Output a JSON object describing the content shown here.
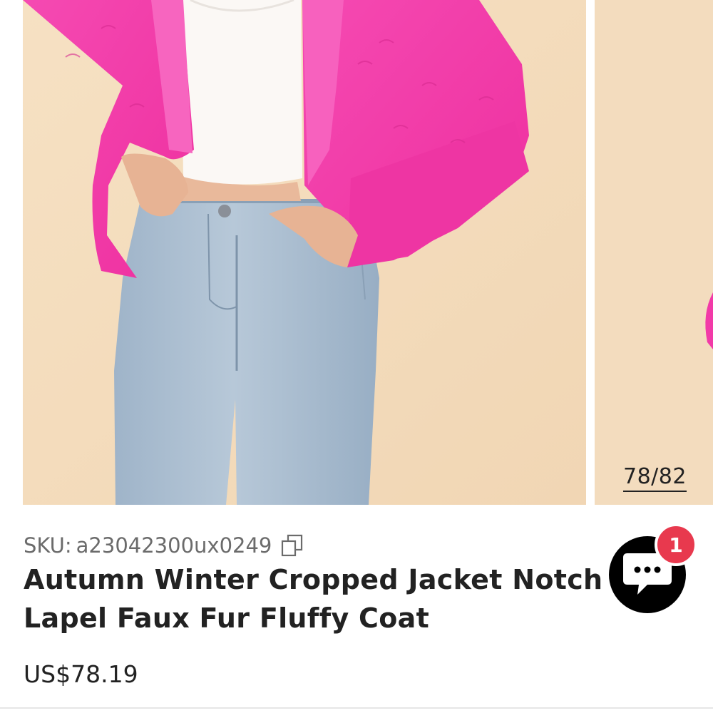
{
  "gallery": {
    "counter": "78/82",
    "current_image": 78,
    "total_images": 82
  },
  "product": {
    "sku_label": "SKU:",
    "sku_value": "a23042300ux0249",
    "title_line1": "Autumn Winter Cropped Jacket Notch",
    "title_line2": "Lapel Faux Fur Fluffy Coat",
    "price": "US$78.19"
  },
  "chat": {
    "badge_count": "1",
    "icon": "chat-bubble-icon"
  },
  "colors": {
    "background_beige": "#f4ddbf",
    "jacket_pink": "#f23aa8",
    "badge_red": "#e8394e",
    "text_dark": "#222222",
    "text_muted": "#6b6b6b"
  }
}
